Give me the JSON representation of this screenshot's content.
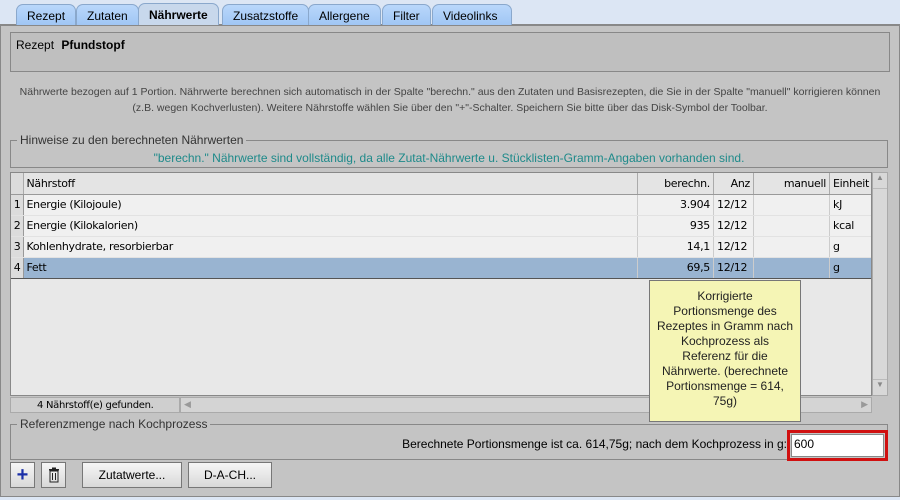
{
  "tabs": [
    {
      "label": "Rezept"
    },
    {
      "label": "Zutaten"
    },
    {
      "label": "Nährwerte"
    },
    {
      "label": "Zusatzstoffe"
    },
    {
      "label": "Allergene"
    },
    {
      "label": "Filter"
    },
    {
      "label": "Videolinks"
    }
  ],
  "recipe": {
    "label": "Rezept",
    "name": "Pfundstopf"
  },
  "info_text": "Nährwerte bezogen auf 1 Portion. Nährwerte berechnen sich automatisch in der Spalte \"berechn.\" aus den Zutaten und Basisrezepten, die Sie in der Spalte \"manuell\" korrigieren können (z.B. wegen Kochverlusten). Weitere Nährstoffe wählen Sie über den \"+\"-Schalter. Speichern Sie bitte über das Disk-Symbol der Toolbar.",
  "hints": {
    "title": "Hinweise zu den berechneten Nährwerten",
    "message": "\"berechn.\" Nährwerte sind vollständig, da alle Zutat-Nährwerte u. Stücklisten-Gramm-Angaben vorhanden sind."
  },
  "table": {
    "columns": [
      "Nährstoff",
      "berechn.",
      "Anz",
      "manuell",
      "Einheit"
    ],
    "rows": [
      {
        "idx": "1",
        "name": "Energie (Kilojoule)",
        "calc": "3.904",
        "anz": "12/12",
        "manual": "",
        "unit": "kJ"
      },
      {
        "idx": "2",
        "name": "Energie (Kilokalorien)",
        "calc": "935",
        "anz": "12/12",
        "manual": "",
        "unit": "kcal"
      },
      {
        "idx": "3",
        "name": "Kohlenhydrate, resorbierbar",
        "calc": "14,1",
        "anz": "12/12",
        "manual": "",
        "unit": "g"
      },
      {
        "idx": "4",
        "name": "Fett",
        "calc": "69,5",
        "anz": "12/12",
        "manual": "",
        "unit": "g"
      }
    ],
    "status": "4  Nährstoff(e) gefunden."
  },
  "reference": {
    "title": "Referenzmenge nach Kochprozess",
    "label": "Berechnete Portionsmenge ist ca. 614,75g; nach dem Kochprozess in g:",
    "value": "600"
  },
  "tooltip": "Korrigierte Portionsmenge des Rezeptes in Gramm nach Kochprozess als Referenz für die Nährwerte. (berechnete Portionsmenge = 614, 75g)",
  "buttons": {
    "add": "+",
    "zutatwerte": "Zutatwerte...",
    "dach": "D-A-CH..."
  }
}
